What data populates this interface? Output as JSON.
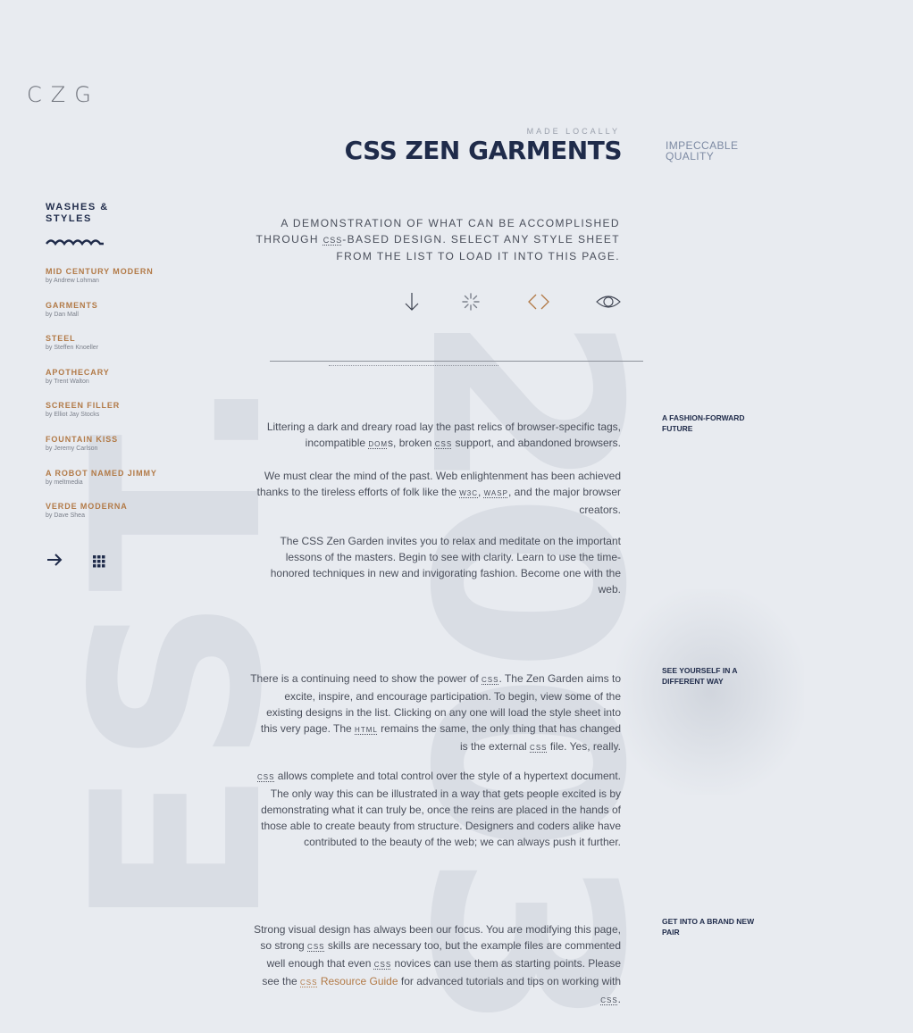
{
  "brand": {
    "logo": "CZG",
    "made_locally": "MADE LOCALLY",
    "title": "CSS ZEN GARMENTS",
    "quality_line1": "IMPECCABLE",
    "quality_line2": "QUALITY"
  },
  "background": {
    "est": "EST.",
    "year": "2003"
  },
  "intro": {
    "part1": "A DEMONSTRATION OF WHAT CAN BE ACCOMPLISHED THROUGH",
    "abbr_css": "CSS",
    "part2": "-BASED DESIGN. SELECT ANY STYLE SHEET FROM THE LIST TO LOAD IT INTO THIS PAGE."
  },
  "icons": [
    "arrow-down-icon",
    "loading-spinner-icon",
    "code-brackets-icon",
    "eye-icon"
  ],
  "sidebar": {
    "heading_line1": "WASHES &",
    "heading_line2": "STYLES",
    "items": [
      {
        "name": "MID CENTURY MODERN",
        "author": "by Andrew Lohman"
      },
      {
        "name": "GARMENTS",
        "author": "by Dan Mall"
      },
      {
        "name": "STEEL",
        "author": "by Steffen Knoeller"
      },
      {
        "name": "APOTHECARY",
        "author": "by Trent Walton"
      },
      {
        "name": "SCREEN FILLER",
        "author": "by Elliot Jay Stocks"
      },
      {
        "name": "FOUNTAIN KISS",
        "author": "by Jeremy Carlson"
      },
      {
        "name": "A ROBOT NAMED JIMMY",
        "author": "by meltmedia"
      },
      {
        "name": "VERDE MODERNA",
        "author": "by Dave Shea"
      }
    ],
    "next_icon": "arrow-right-icon",
    "all_icon": "grid-icon"
  },
  "sections": {
    "labels": [
      "A FASHION-FORWARD FUTURE",
      "SEE YOURSELF IN A DIFFERENT WAY",
      "GET INTO A BRAND NEW PAIR"
    ],
    "p1": {
      "a": "Littering a dark and dreary road lay the past relics of browser-specific tags, incompatible ",
      "abbr1": "DOM",
      "b": "s, broken ",
      "abbr2": "CSS",
      "c": " support, and abandoned browsers."
    },
    "p2": {
      "a": "We must clear the mind of the past. Web enlightenment has been achieved thanks to the tireless efforts of folk like the ",
      "abbr1": "W3C",
      "b": ", ",
      "abbr2": "WASP",
      "c": ", and the major browser creators."
    },
    "p3": "The CSS Zen Garden invites you to relax and meditate on the important lessons of the masters. Begin to see with clarity. Learn to use the time-honored techniques in new and invigorating fashion. Become one with the web.",
    "p4": {
      "a": "There is a continuing need to show the power of ",
      "abbr1": "CSS",
      "b": ". The Zen Garden aims to excite, inspire, and encourage participation. To begin, view some of the existing designs in the list. Clicking on any one will load the style sheet into this very page. The ",
      "abbr2": "HTML",
      "c": " remains the same, the only thing that has changed is the external ",
      "abbr3": "CSS",
      "d": " file. Yes, really."
    },
    "p5": {
      "abbr1": "CSS",
      "a": " allows complete and total control over the style of a hypertext document. The only way this can be illustrated in a way that gets people excited is by demonstrating what it can truly be, once the reins are placed in the hands of those able to create beauty from structure. Designers and coders alike have contributed to the beauty of the web; we can always push it further."
    },
    "p6": {
      "a": "Strong visual design has always been our focus. You are modifying this page, so strong ",
      "abbr1": "CSS",
      "b": " skills are necessary too, but the example files are commented well enough that even ",
      "abbr2": "CSS",
      "c": " novices can use them as starting points. Please see the ",
      "abbr3": "CSS",
      "link": " Resource Guide",
      "d": " for advanced tutorials and tips on working with ",
      "abbr4": "CSS",
      "e": "."
    }
  },
  "colors": {
    "background": "#e8ebf0",
    "navy": "#1f2b4a",
    "accent": "#b27a47",
    "text": "#4a4f5b"
  }
}
